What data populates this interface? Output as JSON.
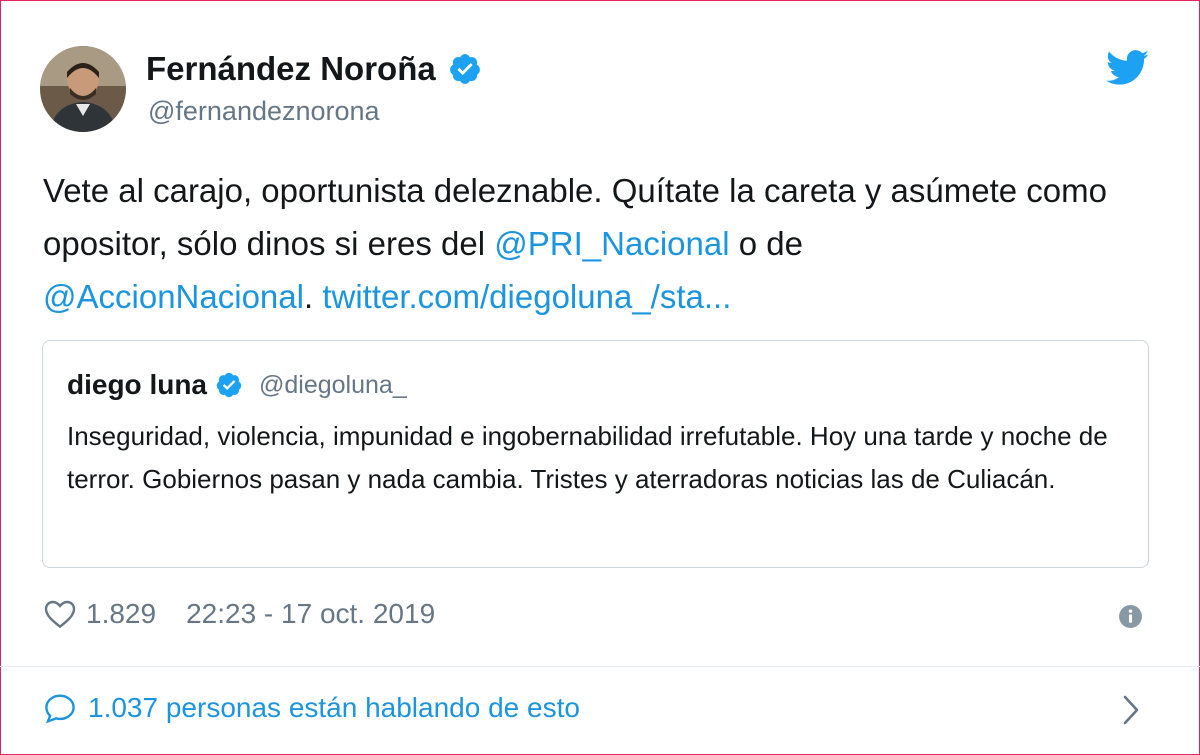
{
  "tweet": {
    "author_name": "Fernández Noroña",
    "author_handle": "@fernandeznorona",
    "verified": true,
    "text_parts": {
      "t1": "Vete al carajo, oportunista deleznable. Quítate la careta y asúmete como opositor, sólo dinos si eres del ",
      "mention1": "@PRI_Nacional",
      "t2": " o de ",
      "mention2": "@AccionNacional",
      "t3": ". ",
      "link": "twitter.com/diegoluna_/sta..."
    },
    "likes": "1.829",
    "timestamp": "22:23 - 17 oct. 2019"
  },
  "quoted_tweet": {
    "author_name": "diego luna",
    "author_handle": "@diegoluna_",
    "verified": true,
    "text": "Inseguridad, violencia, impunidad e ingobernabilidad irrefutable. Hoy una tarde y noche de terror. Gobiernos pasan y nada cambia. Tristes y aterradoras noticias las de Culiacán."
  },
  "footer": {
    "conversation_label": "1.037 personas están hablando de esto"
  },
  "icons": {
    "brand": "twitter-bird-icon",
    "verified": "verified-badge-icon",
    "like": "heart-icon",
    "info": "info-icon",
    "reply": "speech-bubble-icon",
    "more": "chevron-right-icon"
  },
  "colors": {
    "accent": "#1b95e0",
    "text": "#14171a",
    "secondary": "#657786",
    "border": "#ccd6dd",
    "frame": "#e0245e"
  }
}
